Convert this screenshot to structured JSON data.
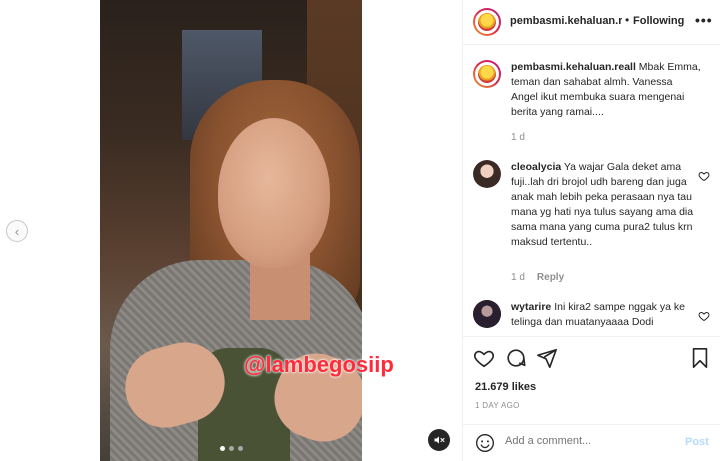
{
  "post": {
    "watermark": "@lambegosiip",
    "carousel_dots": 3,
    "active_dot": 1
  },
  "header": {
    "username": "pembasmi.kehaluan.re",
    "separator": "•",
    "follow_label": "Following",
    "more": "•••"
  },
  "caption": {
    "username": "pembasmi.kehaluan.reall",
    "text": " Mbak Emma, teman dan sahabat almh. Vanessa Angel ikut membuka suara mengenai berita yang ramai....",
    "time": "1 d"
  },
  "comments": [
    {
      "username": "cleoalycia",
      "text": " Ya wajar Gala deket ama fuji..lah dri brojol udh bareng dan juga anak mah lebih peka perasaan nya tau mana yg hati nya tulus sayang ama dia sama mana yang cuma pura2 tulus krn maksud tertentu..",
      "time": "1 d",
      "reply_label": "Reply"
    },
    {
      "username": "wytarire",
      "text": " Ini kira2 sampe nggak ya ke telinga dan muatanyaaaa Dodi",
      "time": "",
      "reply_label": ""
    }
  ],
  "actions": {
    "likes": "21.679 likes",
    "date": "1 DAY AGO"
  },
  "add_comment": {
    "placeholder": "Add a comment...",
    "post_label": "Post"
  },
  "colors": {
    "link_blue": "#0095f6",
    "post_disabled": "#b3dbff",
    "watermark_red": "#ff2b3b",
    "muted_text": "#8e8e8e"
  }
}
